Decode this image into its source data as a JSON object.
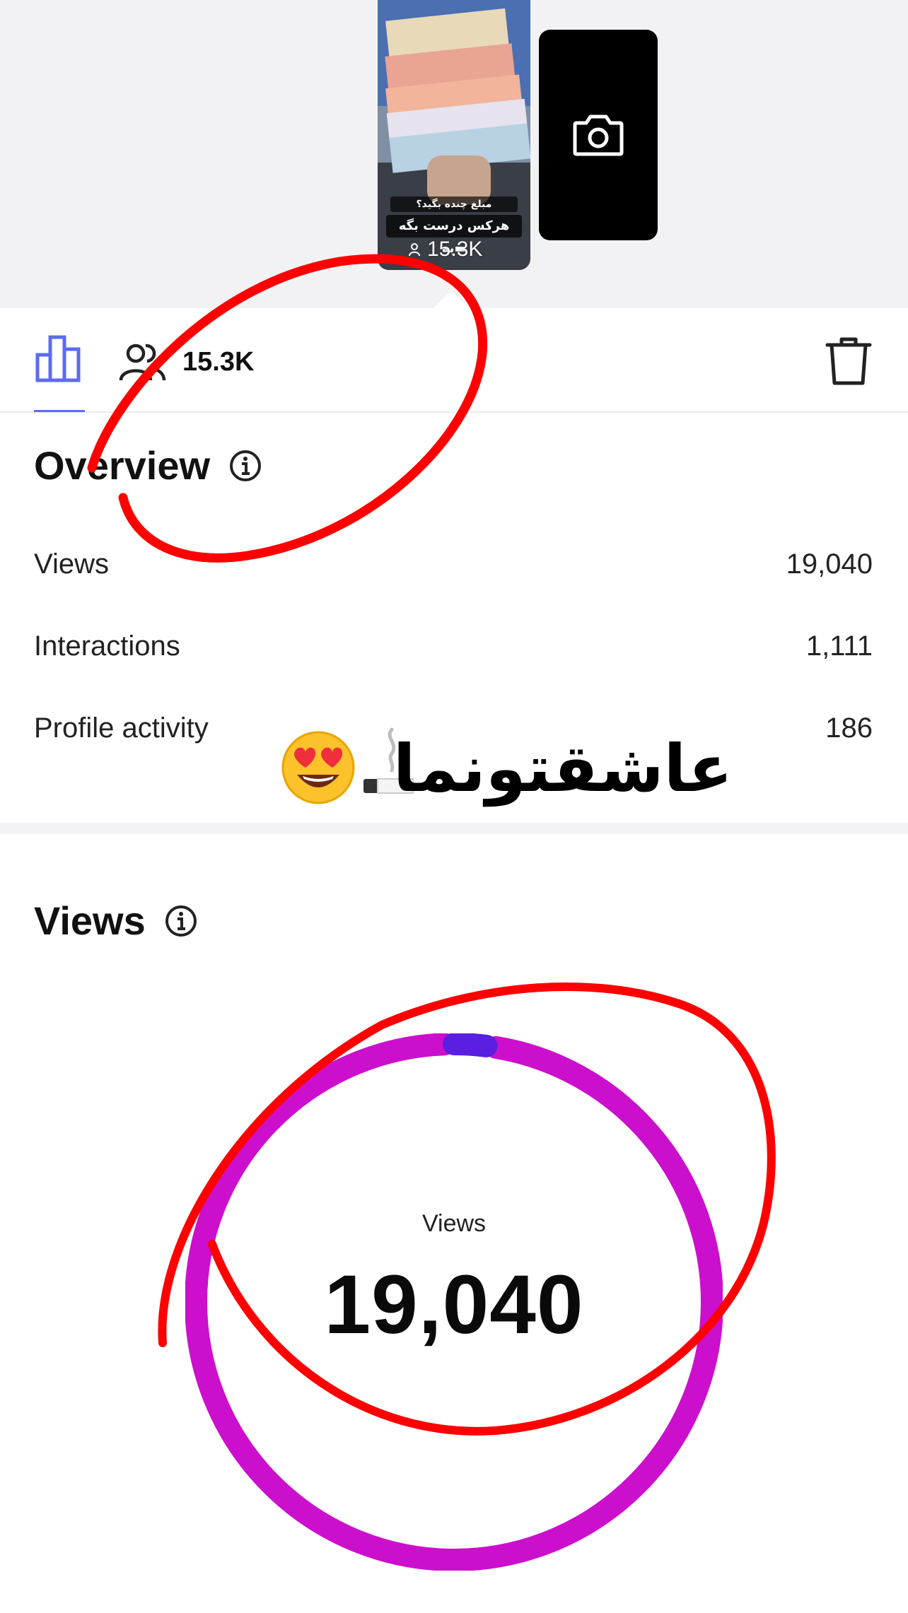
{
  "story": {
    "caption_line_1": "مبلغ چنده بگید؟",
    "caption_line_2": "هرکس درست بگه ▬به",
    "views": "15.3K"
  },
  "tabs": {
    "insights_icon": "bar-chart-icon",
    "followers_icon": "people-icon",
    "followers_count": "15.3K",
    "delete_icon": "trash-icon",
    "accent_color": "#5b6cf0"
  },
  "overview": {
    "title": "Overview",
    "metrics": [
      {
        "label": "Views",
        "value": "19,040"
      },
      {
        "label": "Interactions",
        "value": "1,111"
      },
      {
        "label": "Profile activity",
        "value": "186"
      }
    ]
  },
  "views_section": {
    "title": "Views",
    "donut_label": "Views",
    "donut_value": "19,040",
    "ring_color": "#cc0fcc",
    "segment_color": "#5a1fe0",
    "segment_fraction": 0.02
  },
  "overlay": {
    "sticker_text": "عاشقتونما",
    "sticker_emojis": [
      "cigarette",
      "heart-eyes-emoji"
    ],
    "scribble_color": "#ff0000"
  }
}
